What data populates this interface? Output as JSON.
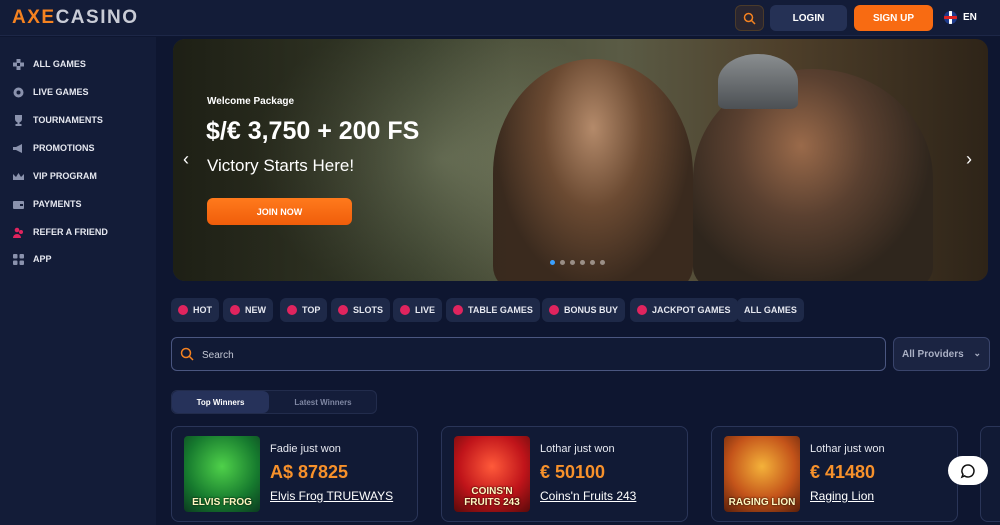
{
  "header": {
    "logo_axe": "AXE",
    "logo_casino": "CASINO",
    "login_label": "LOGIN",
    "signup_label": "SIGN UP",
    "language": "EN",
    "icons": {
      "search": "search-icon",
      "flag": "uk-flag-icon"
    }
  },
  "sidebar": {
    "items": [
      {
        "label": "ALL GAMES",
        "icon": "games-icon"
      },
      {
        "label": "LIVE GAMES",
        "icon": "live-icon"
      },
      {
        "label": "TOURNAMENTS",
        "icon": "trophy-icon"
      },
      {
        "label": "PROMOTIONS",
        "icon": "megaphone-icon"
      },
      {
        "label": "VIP PROGRAM",
        "icon": "crown-icon"
      },
      {
        "label": "PAYMENTS",
        "icon": "wallet-icon"
      },
      {
        "label": "REFER A FRIEND",
        "icon": "users-icon"
      },
      {
        "label": "APP",
        "icon": "app-grid-icon"
      }
    ]
  },
  "banner": {
    "subtitle": "Welcome Package",
    "amount": "$/€ 3,750 + 200 FS",
    "tagline": "Victory Starts Here!",
    "cta_label": "JOIN NOW",
    "slide_count": 6,
    "active_slide": 1
  },
  "categories": [
    {
      "label": "HOT"
    },
    {
      "label": "NEW"
    },
    {
      "label": "TOP"
    },
    {
      "label": "SLOTS"
    },
    {
      "label": "LIVE"
    },
    {
      "label": "TABLE GAMES"
    },
    {
      "label": "BONUS BUY"
    },
    {
      "label": "JACKPOT GAMES"
    },
    {
      "label": "ALL GAMES"
    }
  ],
  "search": {
    "placeholder": "Search",
    "providers_label": "All Providers"
  },
  "winners": {
    "tabs": [
      "Top Winners",
      "Latest Winners"
    ],
    "active_tab": "Top Winners",
    "cards": [
      {
        "who": "Fadie just won",
        "amount": "A$ 87825",
        "game": "Elvis Frog TRUEWAYS",
        "thumb_text": "ELVIS FROG"
      },
      {
        "who": "Lothar just won",
        "amount": "€ 50100",
        "game": "Coins'n Fruits 243",
        "thumb_text": "COINS'N FRUITS 243"
      },
      {
        "who": "Lothar just won",
        "amount": "€ 41480",
        "game": "Raging Lion",
        "thumb_text": "RAGING LION"
      }
    ]
  },
  "colors": {
    "accent_orange": "#f86b12",
    "background": "#0e1630",
    "sidebar": "#131c38",
    "win_amount": "#f7912b"
  }
}
